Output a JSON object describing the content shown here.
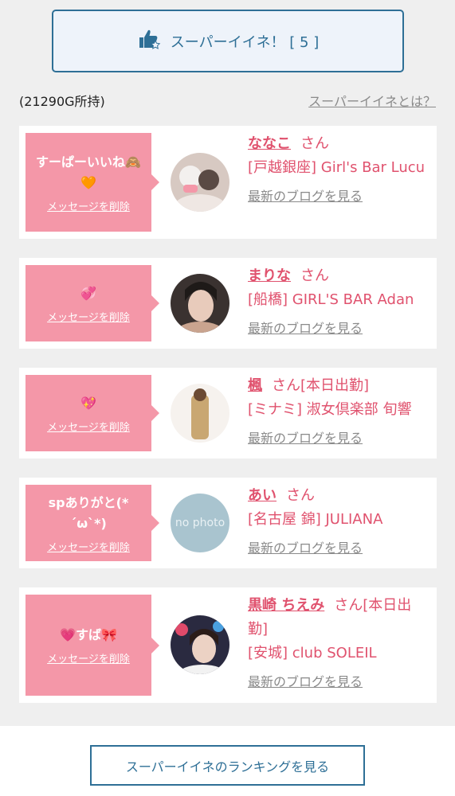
{
  "super_button": {
    "icon": "thumbs-up-star-icon",
    "label": "スーパーイイネ！ [ 5 ]"
  },
  "owned": "(21290G所持)",
  "about_link": "スーパーイイネとは？",
  "delete_label": "メッセージを削除",
  "blog_label": "最新のブログを見る",
  "san": "さん",
  "cards": [
    {
      "message": "すーぱーいいね🙈🧡",
      "name": "ななこ",
      "suffix": "",
      "shop": "[戸越銀座] Girl's Bar Lucu"
    },
    {
      "message": "💞",
      "name": "まりな",
      "suffix": "",
      "shop": "[船橋] GIRL'S BAR Adan"
    },
    {
      "message": "💖",
      "name": "楓",
      "suffix": "[本日出勤]",
      "shop": "[ミナミ] 淑女倶楽部 旬響"
    },
    {
      "message": "spありがと(*´ω`*)",
      "name": "あい",
      "suffix": "",
      "shop": "[名古屋 錦] JULIANA",
      "avatar_text": "no photo"
    },
    {
      "message": "💗すば🎀",
      "name": "黒崎 ちえみ",
      "suffix": "[本日出勤]",
      "shop": "[安城] club SOLEIL"
    }
  ],
  "ranking_button": "スーパーイイネのランキングを見る"
}
